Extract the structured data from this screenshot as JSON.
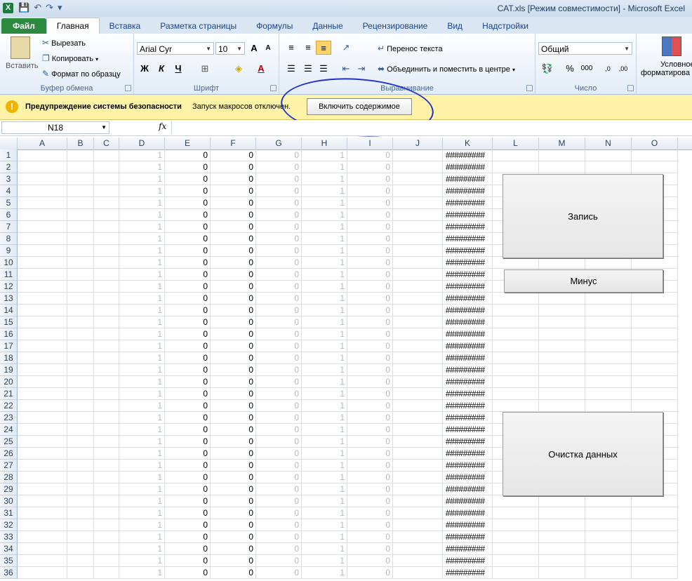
{
  "window": {
    "title": "CAT.xls  [Режим совместимости] - Microsoft Excel"
  },
  "tabs": [
    "Файл",
    "Главная",
    "Вставка",
    "Разметка страницы",
    "Формулы",
    "Данные",
    "Рецензирование",
    "Вид",
    "Надстройки"
  ],
  "ribbon": {
    "clipboard": {
      "paste": "Вставить",
      "cut": "Вырезать",
      "copy": "Копировать",
      "format_painter": "Формат по образцу",
      "label": "Буфер обмена"
    },
    "font": {
      "name": "Arial Cyr",
      "size": "10",
      "bold": "Ж",
      "italic": "К",
      "underline": "Ч",
      "grow": "A",
      "shrink": "A",
      "color": "A",
      "label": "Шрифт"
    },
    "alignment": {
      "wrap": "Перенос текста",
      "merge": "Объединить и поместить в центре",
      "label": "Выравнивание"
    },
    "number": {
      "format": "Общий",
      "percent": "%",
      "thousands": "000",
      "inc_dec": ",0",
      "dec_dec": ",00",
      "label": "Число"
    },
    "styles": {
      "conditional_line1": "Условное",
      "conditional_line2": "форматирова"
    }
  },
  "security": {
    "title": "Предупреждение системы безопасности",
    "message": "Запуск макросов отключен.",
    "enable_button": "Включить содержимое"
  },
  "formula_bar": {
    "name_box": "N18",
    "fx": "fx",
    "value": ""
  },
  "columns": [
    {
      "name": "A"
    },
    {
      "name": "B"
    },
    {
      "name": "C"
    },
    {
      "name": "D"
    },
    {
      "name": "E"
    },
    {
      "name": "F"
    },
    {
      "name": "G"
    },
    {
      "name": "H"
    },
    {
      "name": "I"
    },
    {
      "name": "J"
    },
    {
      "name": "K"
    },
    {
      "name": "L"
    },
    {
      "name": "M"
    },
    {
      "name": "N"
    },
    {
      "name": "O"
    }
  ],
  "rows": {
    "first": 1,
    "last": 36
  },
  "row_values": {
    "D": "1",
    "E": "0",
    "F": "0",
    "G": "0",
    "H": "1",
    "I": "0",
    "K": "#########"
  },
  "sheet_buttons": {
    "record": "Запись",
    "minus": "Минус",
    "clear": "Очистка данных"
  },
  "colors": {
    "file_tab": "#2b8a3e",
    "security_bar": "#fff3a8",
    "annotation": "#2233cc"
  }
}
